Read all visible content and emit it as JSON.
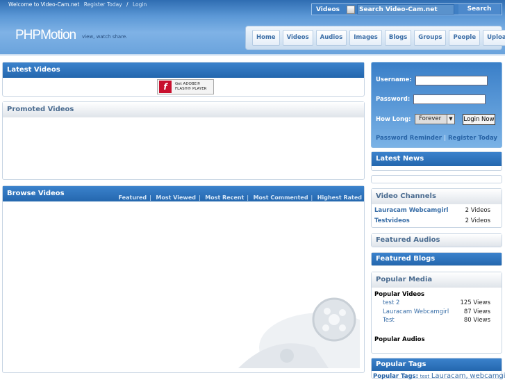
{
  "topbar": {
    "welcome": "Welcome to Video-Cam.net",
    "register": "Register Today",
    "separator": "/",
    "login": "Login"
  },
  "search": {
    "type": "Videos",
    "placeholder": "Search Video-Cam.net",
    "button": "Search"
  },
  "logo": {
    "text": "PHPMotion",
    "slogan": "view, watch share."
  },
  "nav": [
    "Home",
    "Videos",
    "Audios",
    "Images",
    "Blogs",
    "Groups",
    "People",
    "Upload"
  ],
  "latest_videos": {
    "title": "Latest Videos",
    "flash_badge": {
      "line1": "Get ADOBE®",
      "line2": "FLASH® PLAYER",
      "icon": "flash-icon"
    }
  },
  "promoted_videos": {
    "title": "Promoted Videos"
  },
  "browse_videos": {
    "title": "Browse Videos",
    "links": [
      "Featured",
      "Most Viewed",
      "Most Recent",
      "Most Commented",
      "Highest Rated"
    ]
  },
  "login": {
    "username_label": "Username:",
    "password_label": "Password:",
    "how_long_label": "How Long:",
    "how_long_value": "Forever",
    "button": "Login Now",
    "reminder": "Password Reminder",
    "register": "Register Today"
  },
  "latest_news": {
    "title": "Latest News"
  },
  "video_channels": {
    "title": "Video Channels",
    "items": [
      {
        "name": "Lauracam Webcamgirl",
        "count": "2 Videos"
      },
      {
        "name": "Testvideos",
        "count": "2 Videos"
      }
    ]
  },
  "featured_audios": {
    "title": "Featured Audios"
  },
  "featured_blogs": {
    "title": "Featured Blogs"
  },
  "popular_media": {
    "title": "Popular Media",
    "videos_label": "Popular Videos",
    "videos": [
      {
        "name": "test 2",
        "views": "125 Views"
      },
      {
        "name": "Lauracam Webcamgirl",
        "views": "87 Views"
      },
      {
        "name": "Test",
        "views": "80 Views"
      }
    ],
    "audios_label": "Popular Audios"
  },
  "popular_tags": {
    "title": "Popular Tags",
    "label": "Popular Tags:",
    "tags": [
      "test",
      "Lauracam,",
      "webcamgirl"
    ]
  },
  "colors": {
    "header_blue": "#2f6db2",
    "accent": "#3a6fa8"
  }
}
